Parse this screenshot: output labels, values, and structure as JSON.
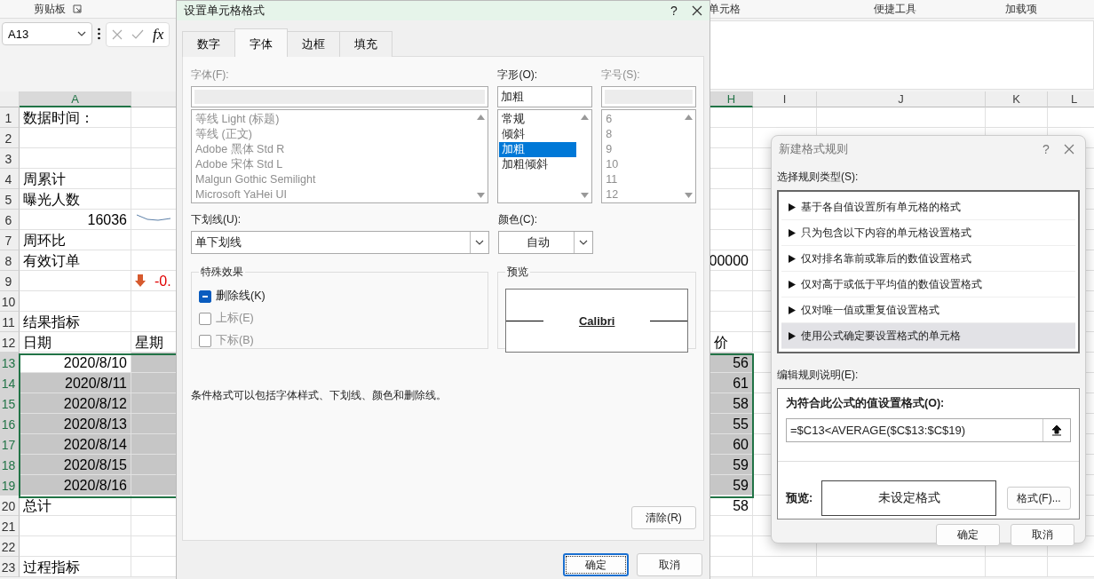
{
  "ribbon": {
    "groups": [
      {
        "label": "剪贴板",
        "launcher": true
      },
      {
        "label": "单元格",
        "launcher": false
      },
      {
        "label": "便捷工具",
        "launcher": false
      },
      {
        "label": "加载项",
        "launcher": false
      }
    ]
  },
  "formula_bar": {
    "name_box": "A13",
    "fx_label": "fx"
  },
  "sheet": {
    "columns": [
      {
        "letter": "A",
        "selected": true
      },
      {
        "letter": "H",
        "selected": true
      },
      {
        "letter": "I",
        "selected": false
      },
      {
        "letter": "J",
        "selected": false
      },
      {
        "letter": "K",
        "selected": false
      },
      {
        "letter": "L",
        "selected": false
      }
    ],
    "rows": [
      {
        "number": "1",
        "selected": false,
        "a": {
          "text": "数据时间：",
          "kind": "text"
        }
      },
      {
        "number": "2",
        "selected": false
      },
      {
        "number": "3",
        "selected": false
      },
      {
        "number": "4",
        "selected": false,
        "a": {
          "text": "周累计",
          "kind": "text"
        }
      },
      {
        "number": "5",
        "selected": false,
        "a": {
          "text": "曝光人数",
          "kind": "text"
        }
      },
      {
        "number": "6",
        "selected": false,
        "a": {
          "text": "16036",
          "kind": "number"
        },
        "b": {
          "kind": "sparkline"
        }
      },
      {
        "number": "7",
        "selected": false,
        "a": {
          "text": "周环比",
          "kind": "text"
        }
      },
      {
        "number": "8",
        "selected": false,
        "a": {
          "text": "有效订单",
          "kind": "text"
        },
        "h": {
          "text": "00000",
          "kind": "number"
        }
      },
      {
        "number": "9",
        "selected": false,
        "b": {
          "text": "-0.",
          "kind": "trend"
        }
      },
      {
        "number": "10",
        "selected": false
      },
      {
        "number": "11",
        "selected": false,
        "a": {
          "text": "结果指标",
          "kind": "text"
        }
      },
      {
        "number": "12",
        "selected": false,
        "a": {
          "text": "日期",
          "kind": "text"
        },
        "b": {
          "text": "星期",
          "kind": "text"
        },
        "h": {
          "text": "价",
          "kind": "text"
        }
      },
      {
        "number": "13",
        "selected": true,
        "a": {
          "text": "2020/8/10",
          "kind": "number"
        },
        "h": {
          "text": "56",
          "kind": "number"
        }
      },
      {
        "number": "14",
        "selected": true,
        "a": {
          "text": "2020/8/11",
          "kind": "number"
        },
        "h": {
          "text": "61",
          "kind": "number"
        }
      },
      {
        "number": "15",
        "selected": true,
        "a": {
          "text": "2020/8/12",
          "kind": "number"
        },
        "h": {
          "text": "58",
          "kind": "number"
        }
      },
      {
        "number": "16",
        "selected": true,
        "a": {
          "text": "2020/8/13",
          "kind": "number"
        },
        "h": {
          "text": "55",
          "kind": "number"
        }
      },
      {
        "number": "17",
        "selected": true,
        "a": {
          "text": "2020/8/14",
          "kind": "number"
        },
        "h": {
          "text": "60",
          "kind": "number"
        }
      },
      {
        "number": "18",
        "selected": true,
        "a": {
          "text": "2020/8/15",
          "kind": "number"
        },
        "h": {
          "text": "59",
          "kind": "number"
        }
      },
      {
        "number": "19",
        "selected": true,
        "a": {
          "text": "2020/8/16",
          "kind": "number"
        },
        "h": {
          "text": "59",
          "kind": "number"
        }
      },
      {
        "number": "20",
        "selected": false,
        "a": {
          "text": "总计",
          "kind": "text"
        },
        "h": {
          "text": "58",
          "kind": "number"
        }
      },
      {
        "number": "21",
        "selected": false
      },
      {
        "number": "22",
        "selected": false
      },
      {
        "number": "23",
        "selected": false,
        "a": {
          "text": "过程指标",
          "kind": "text"
        }
      }
    ]
  },
  "format_cells_dialog": {
    "title": "设置单元格格式",
    "help_label": "?",
    "tabs": [
      {
        "label": "数字",
        "selected": false
      },
      {
        "label": "字体",
        "selected": true
      },
      {
        "label": "边框",
        "selected": false
      },
      {
        "label": "填充",
        "selected": false
      }
    ],
    "font": {
      "label": "字体(F):",
      "disabled": true,
      "items": [
        {
          "label": "等线 Light (标题)",
          "selected": false
        },
        {
          "label": "等线 (正文)",
          "selected": false
        },
        {
          "label": "Adobe 黑体 Std R",
          "selected": false
        },
        {
          "label": "Adobe 宋体 Std L",
          "selected": false
        },
        {
          "label": "Malgun Gothic Semilight",
          "selected": false
        },
        {
          "label": "Microsoft YaHei UI",
          "selected": false
        }
      ]
    },
    "style": {
      "label": "字形(O):",
      "value": "加粗",
      "disabled": false,
      "items": [
        {
          "label": "常规",
          "selected": false
        },
        {
          "label": "倾斜",
          "selected": false
        },
        {
          "label": "加粗",
          "selected": true
        },
        {
          "label": "加粗倾斜",
          "selected": false
        }
      ]
    },
    "size": {
      "label": "字号(S):",
      "disabled": true,
      "items": [
        {
          "label": "6",
          "selected": false
        },
        {
          "label": "8",
          "selected": false
        },
        {
          "label": "9",
          "selected": false
        },
        {
          "label": "10",
          "selected": false
        },
        {
          "label": "11",
          "selected": false
        },
        {
          "label": "12",
          "selected": false
        }
      ]
    },
    "underline": {
      "label": "下划线(U):",
      "value": "单下划线"
    },
    "color": {
      "label": "颜色(C):",
      "value": "自动"
    },
    "effects": {
      "title": "特殊效果",
      "options": [
        {
          "label": "删除线(K)",
          "indeterminate": true,
          "disabled": false
        },
        {
          "label": "上标(E)",
          "indeterminate": false,
          "disabled": true
        },
        {
          "label": "下标(B)",
          "indeterminate": false,
          "disabled": true
        }
      ]
    },
    "preview": {
      "title": "预览",
      "sample": "Calibri"
    },
    "note": "条件格式可以包括字体样式、下划线、颜色和删除线。",
    "clear_button": "清除(R)",
    "buttons": [
      {
        "label": "确定",
        "focused": true
      },
      {
        "label": "取消",
        "focused": false
      }
    ]
  },
  "rule_dialog": {
    "title": "新建格式规则",
    "help_label": "?",
    "type_label": "选择规则类型(S):",
    "rule_types": [
      {
        "label": "基于各自值设置所有单元格的格式",
        "selected": false
      },
      {
        "label": "只为包含以下内容的单元格设置格式",
        "selected": false
      },
      {
        "label": "仅对排名靠前或靠后的数值设置格式",
        "selected": false
      },
      {
        "label": "仅对高于或低于平均值的数值设置格式",
        "selected": false
      },
      {
        "label": "仅对唯一值或重复值设置格式",
        "selected": false
      },
      {
        "label": "使用公式确定要设置格式的单元格",
        "selected": true
      }
    ],
    "edit_label": "编辑规则说明(E):",
    "formula_label": "为符合此公式的值设置格式(O):",
    "formula": "=$C13<AVERAGE($C$13:$C$19)",
    "preview_label": "预览:",
    "preview_text": "未设定格式",
    "format_button": "格式(F)...",
    "buttons": [
      "确定",
      "取消"
    ]
  }
}
